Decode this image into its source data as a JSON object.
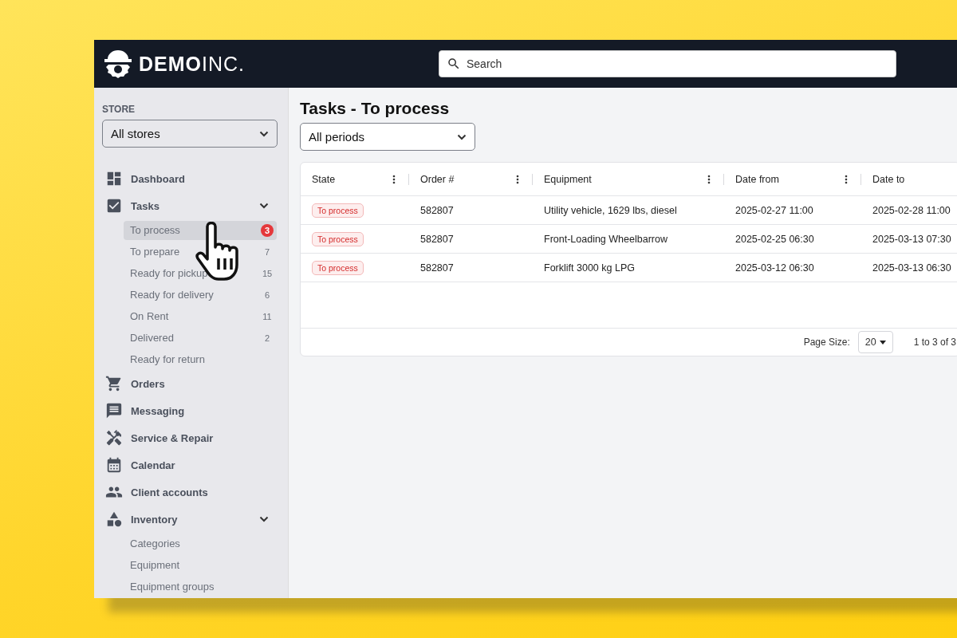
{
  "header": {
    "logo": "**DEMO**INC.",
    "search": {
      "placeholder": "Search"
    }
  },
  "sidebar": {
    "store_label": "STORE",
    "store_select": "All stores",
    "nav": [
      {
        "kind": "dashboard",
        "label": "Dashboard"
      },
      {
        "kind": "tasks",
        "label": "Tasks",
        "expanded": true,
        "children": [
          {
            "label": "To process",
            "count": "3",
            "selected": true,
            "alert": true
          },
          {
            "label": "To prepare",
            "count": "7",
            "selected": false,
            "alert": false
          },
          {
            "label": "Ready for pickup",
            "count": "15",
            "selected": false,
            "alert": false
          },
          {
            "label": "Ready for delivery",
            "count": "6",
            "selected": false,
            "alert": false
          },
          {
            "label": "On Rent",
            "count": "11",
            "selected": false,
            "alert": false
          },
          {
            "label": "Delivered",
            "count": "2",
            "selected": false,
            "alert": false
          },
          {
            "label": "Ready for return",
            "selected": false
          }
        ]
      },
      {
        "kind": "orders",
        "label": "Orders"
      },
      {
        "kind": "messaging",
        "label": "Messaging"
      },
      {
        "kind": "service",
        "label": "Service & Repair"
      },
      {
        "kind": "calendar",
        "label": "Calendar"
      },
      {
        "kind": "clients",
        "label": "Client accounts"
      },
      {
        "kind": "inventory",
        "label": "Inventory",
        "expanded": true,
        "children": [
          {
            "label": "Categories",
            "selected": false
          },
          {
            "label": "Equipment",
            "selected": false
          },
          {
            "label": "Equipment groups",
            "selected": false
          }
        ]
      }
    ]
  },
  "main": {
    "title": "Tasks - To process",
    "period_select": "All periods",
    "table": {
      "columns": [
        "State",
        "Order #",
        "Equipment",
        "Date from",
        "Date to"
      ],
      "rows": [
        {
          "state": "To process",
          "order": "582807",
          "equipment": "Utility vehicle, 1629 lbs, diesel",
          "date_from": "2025-02-27 11:00",
          "date_to": "2025-02-28 11:00"
        },
        {
          "state": "To process",
          "order": "582807",
          "equipment": "Front-Loading Wheelbarrow",
          "date_from": "2025-02-25 06:30",
          "date_to": "2025-03-13 07:30"
        },
        {
          "state": "To process",
          "order": "582807",
          "equipment": "Forklift 3000 kg LPG",
          "date_from": "2025-03-12 06:30",
          "date_to": "2025-03-13 06:30"
        }
      ]
    },
    "pagination": {
      "page_size_label": "Page Size:",
      "page_size": "20",
      "range": "1 to 3 of 3"
    }
  }
}
